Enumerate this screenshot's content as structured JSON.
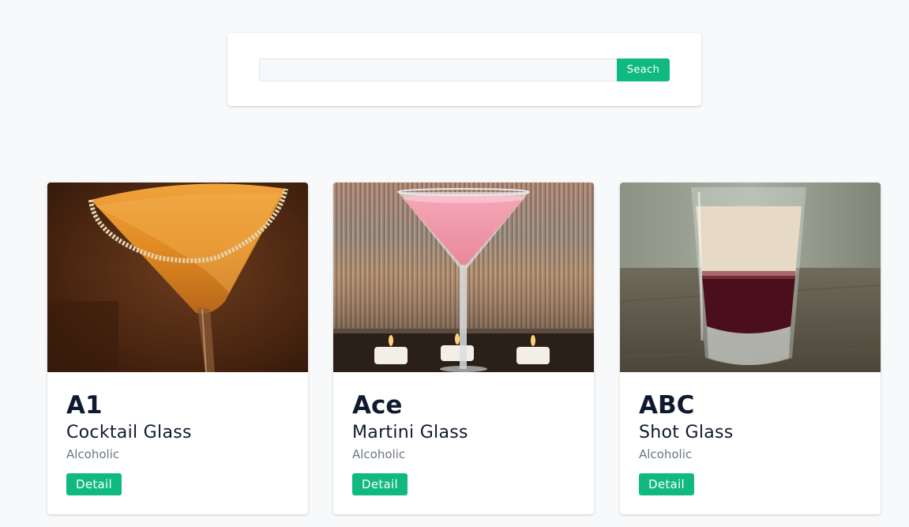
{
  "search": {
    "value": "",
    "placeholder": "",
    "button_label": "Seach"
  },
  "drinks": [
    {
      "name": "A1",
      "glass": "Cocktail Glass",
      "category": "Alcoholic",
      "detail_label": "Detail",
      "image": "orange-cocktail-glass-with-sugared-rim"
    },
    {
      "name": "Ace",
      "glass": "Martini Glass",
      "category": "Alcoholic",
      "detail_label": "Detail",
      "image": "pink-martini-with-candles"
    },
    {
      "name": "ABC",
      "glass": "Shot Glass",
      "category": "Alcoholic",
      "detail_label": "Detail",
      "image": "layered-shot-cream-over-red"
    }
  ],
  "colors": {
    "accent": "#10b981",
    "background": "#f8f9fb",
    "title": "#0f1a2e",
    "muted": "#6b7585"
  }
}
